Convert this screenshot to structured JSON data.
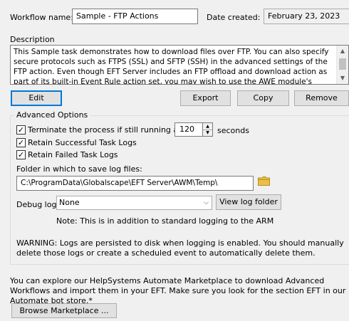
{
  "workflow": {
    "name_label": "Workflow name:*",
    "name_value": "Sample - FTP Actions",
    "date_label": "Date created:",
    "date_value": "February 23, 2023"
  },
  "description": {
    "label": "Description",
    "text": "This Sample task demonstrates how to download files over FTP. You can also specify secure protocols such as FTPS (SSL) and SFTP (SSH) in the advanced settings of the FTP action. Even though EFT Server includes an FTP offload and download action as part of its built-in Event Rule action set, you may wish to use the AWE module's advanced FTP action for"
  },
  "buttons": {
    "edit": "Edit",
    "export": "Export",
    "copy": "Copy",
    "remove": "Remove",
    "view_log_folder": "View log folder",
    "browse_marketplace": "Browse Marketplace ..."
  },
  "advanced": {
    "title": "Advanced Options",
    "terminate_label": "Terminate the process if still running after",
    "terminate_checked": true,
    "terminate_value": "120",
    "terminate_unit": "seconds",
    "retain_success_label": "Retain Successful Task Logs",
    "retain_success_checked": true,
    "retain_failed_label": "Retain Failed Task Logs",
    "retain_failed_checked": true,
    "folder_label": "Folder in which to save log files:",
    "folder_value": "C:\\ProgramData\\Globalscape\\EFT Server\\AWM\\Temp\\",
    "debug_label": "Debug log:",
    "debug_value": "None",
    "note": "Note: This is in addition to standard logging to the ARM",
    "warning": "WARNING: Logs are persisted to disk when logging is enabled. You should manually delete those logs or create a scheduled event to automatically delete them."
  },
  "marketplace": {
    "text": "You can explore our HelpSystems Automate Marketplace to download Advanced Workflows and import them in your EFT. Make sure you look for the section EFT in our Automate bot store.*"
  },
  "icons": {
    "folder": "folder-icon",
    "checkmark": "✓"
  },
  "colors": {
    "background": "#f0f0f0",
    "accent": "#0078d7",
    "folder": "#e8c04a"
  }
}
